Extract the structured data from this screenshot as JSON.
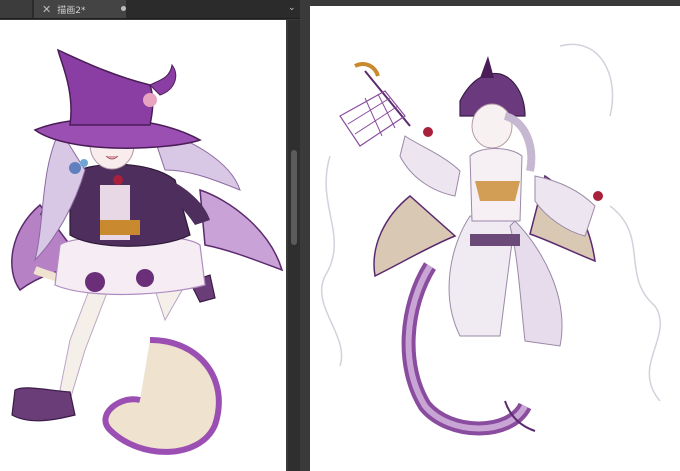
{
  "tabs": [
    {
      "label": "描画2*"
    }
  ],
  "icons": {
    "close": "close-icon",
    "unsaved": "unsaved-dot-icon",
    "caret": "chevron-down-icon"
  },
  "glyphs": {
    "close": "✕",
    "caret": "⌄"
  },
  "colors": {
    "purple_dark": "#5b2a6e",
    "purple": "#9b4fb3",
    "lavender": "#d9c7e6",
    "cream": "#efe3cf",
    "red_accent": "#a8203c",
    "orange_accent": "#c9892e"
  }
}
